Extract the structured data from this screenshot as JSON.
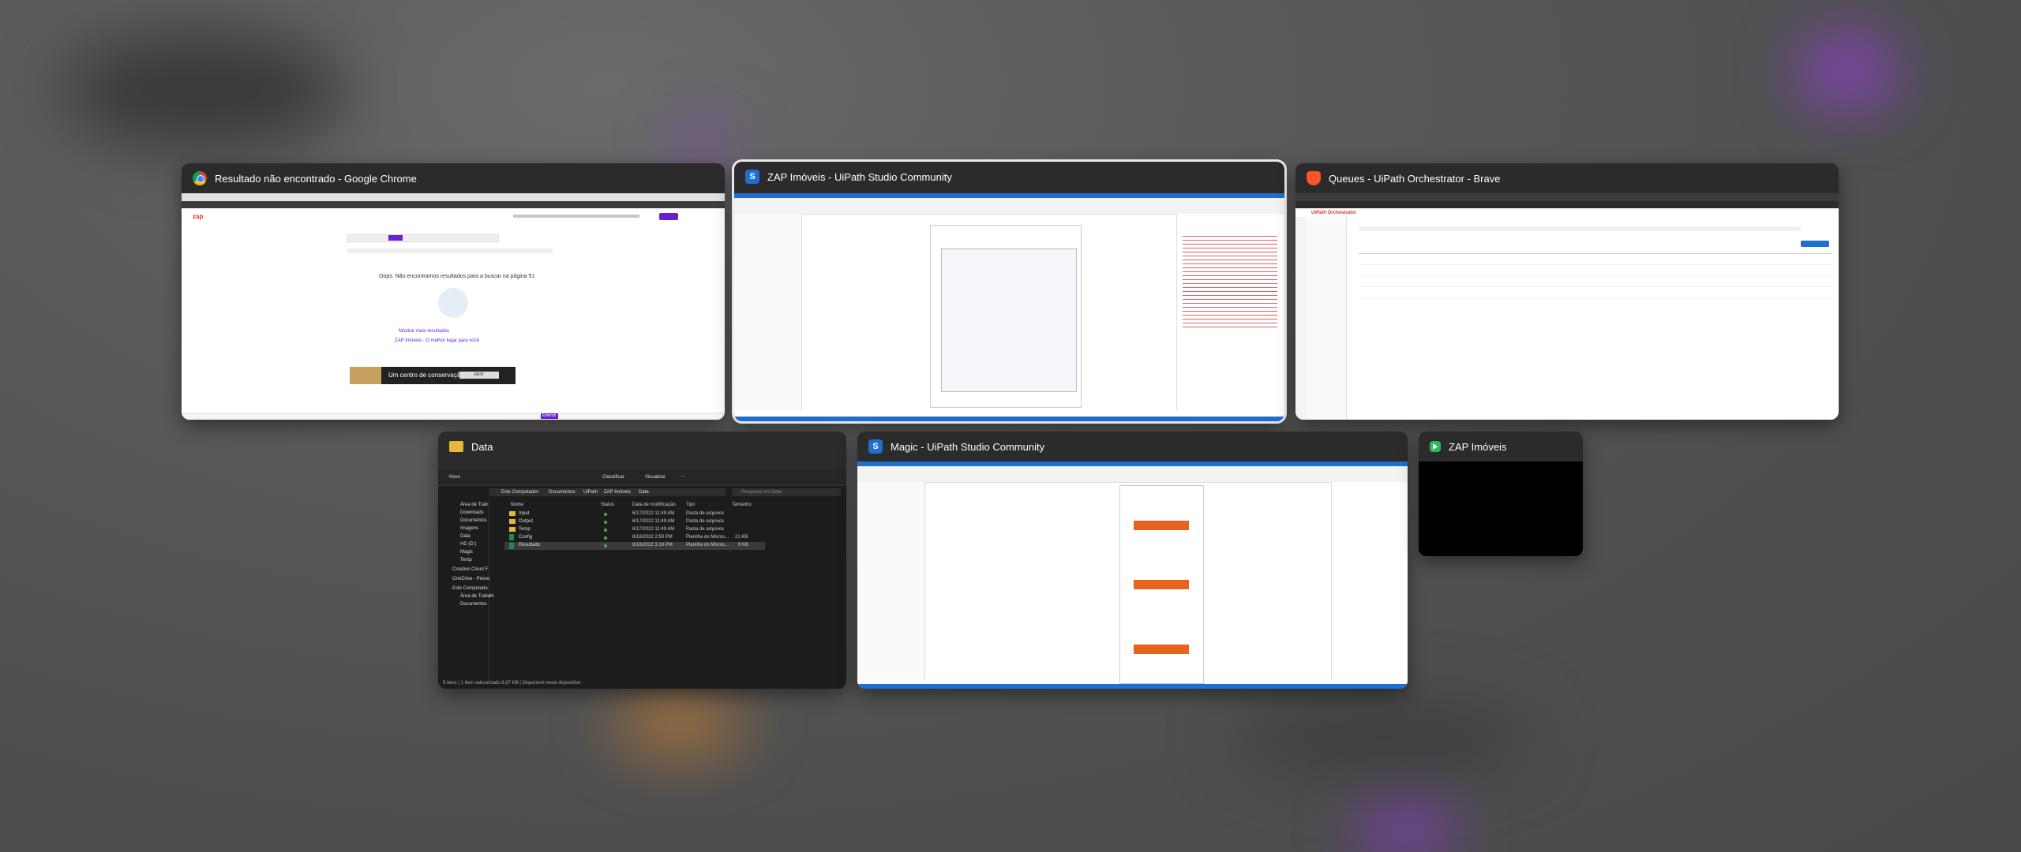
{
  "switcher": {
    "windows": [
      {
        "title": "Resultado não encontrado - Google Chrome",
        "app": "chrome",
        "icon": "chrome-icon"
      },
      {
        "title": "ZAP Imóveis - UiPath Studio Community",
        "app": "uipath-studio",
        "icon": "uipath-studio-icon",
        "selected": true
      },
      {
        "title": "Queues - UiPath Orchestrator - Brave",
        "app": "brave",
        "icon": "brave-icon"
      },
      {
        "title": "Data",
        "app": "file-explorer",
        "icon": "folder-icon"
      },
      {
        "title": "Magic - UiPath Studio Community",
        "app": "uipath-studio",
        "icon": "uipath-studio-icon"
      },
      {
        "title": "ZAP Imóveis",
        "app": "zap-app",
        "icon": "zap-app-icon"
      }
    ]
  },
  "chrome_preview": {
    "brand": "zap",
    "no_results": "Oops. Não encontramos resultados para a buscar na página 51",
    "link_1": "Mostrar mais resultados",
    "link_2": "ZAP Imóveis - O melhor lugar para você",
    "ad_text": "Um centro de conservação",
    "ad_button": "Abrir",
    "accept_button": "Entendi"
  },
  "orchestrator_preview": {
    "brand": "UiPath Orchestrator",
    "page_title": "Queues",
    "add_button": "+ Add Queue"
  },
  "explorer_preview": {
    "toolbar": {
      "new": "Novo",
      "sort": "Classificar",
      "view": "Visualizar",
      "more": "..."
    },
    "breadcrumb": [
      "Este Computador",
      "Documentos",
      "UiPath",
      "ZAP Imóveis",
      "Data"
    ],
    "search_placeholder": "Pesquisar em Data",
    "columns": [
      "Nome",
      "Status",
      "Data de modificação",
      "Tipo",
      "Tamanho"
    ],
    "files": [
      {
        "name": "Input",
        "date": "6/17/2022 11:49 AM",
        "type": "Pasta de arquivos",
        "size": "",
        "kind": "folder"
      },
      {
        "name": "Output",
        "date": "6/17/2022 11:49 AM",
        "type": "Pasta de arquivos",
        "size": "",
        "kind": "folder"
      },
      {
        "name": "Temp",
        "date": "6/17/2022 11:49 AM",
        "type": "Pasta de arquivos",
        "size": "",
        "kind": "folder"
      },
      {
        "name": "Config",
        "date": "6/18/2022 2:50 PM",
        "type": "Planilha do Micros...",
        "size": "21 KB",
        "kind": "excel"
      },
      {
        "name": "Resultado",
        "date": "6/18/2022 3:19 PM",
        "type": "Planilha do Micros...",
        "size": "9 KB",
        "kind": "excel"
      }
    ],
    "sidebar": [
      "Área de Trab",
      "Downloads",
      "Documentos",
      "Imagens",
      "Data",
      "HD (D:)",
      "Magic",
      "Temp",
      "Creative Cloud F",
      "OneDrive - Pesso",
      "Este Computado",
      "Área de Trabalh",
      "Documentos"
    ],
    "status": "5 itens  |  1 item selecionado  8,87 KB  |  Disponível neste dispositivo"
  },
  "colors": {
    "accent_purple": "#6a1fd1",
    "studio_blue": "#1f6fd1",
    "folder_yellow": "#e8b73a",
    "excel_green": "#1f8a4c",
    "zap_green": "#2eb85c",
    "zap_red": "#e5322d"
  }
}
